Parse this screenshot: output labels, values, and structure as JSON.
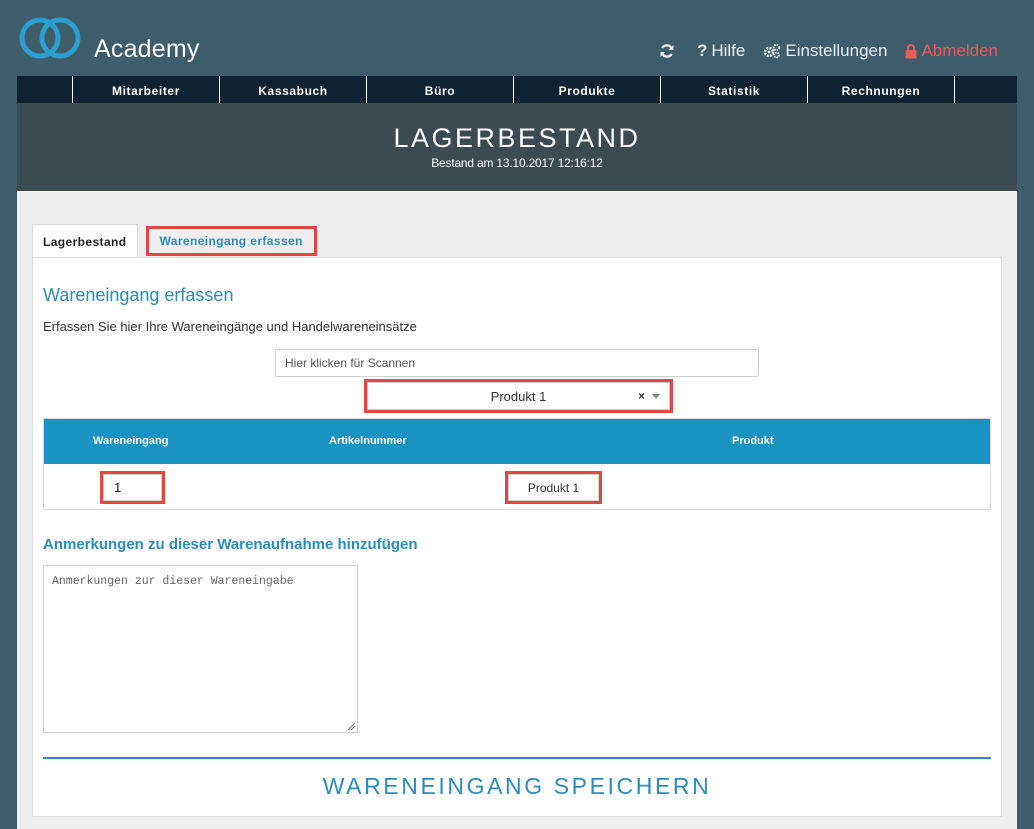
{
  "app": {
    "title": "Academy"
  },
  "top_actions": {
    "refresh_icon": "refresh-icon",
    "help": "Hilfe",
    "settings": "Einstellungen",
    "logout": "Abmelden"
  },
  "nav": {
    "items": [
      "Mitarbeiter",
      "Kassabuch",
      "Büro",
      "Produkte",
      "Statistik",
      "Rechnungen"
    ]
  },
  "banner": {
    "title": "LAGERBESTAND",
    "subtitle": "Bestand am 13.10.2017 12:16:12"
  },
  "tabs": [
    {
      "label": "Lagerbestand",
      "active": true
    },
    {
      "label": "Wareneingang erfassen",
      "active": false
    }
  ],
  "panel": {
    "heading": "Wareneingang erfassen",
    "description": "Erfassen Sie hier Ihre Wareneingänge und Handelwareneinsätze",
    "scan_placeholder": "Hier klicken für Scannen",
    "product_select": {
      "value": "Produkt 1",
      "clear": "×"
    }
  },
  "table": {
    "headers": [
      "Wareneingang",
      "Artikelnummer",
      "Produkt"
    ],
    "rows": [
      {
        "wareneingang": "1",
        "artikelnummer": "",
        "produkt": "Produkt 1"
      }
    ]
  },
  "notes": {
    "heading": "Anmerkungen zu dieser Warenaufnahme hinzufügen",
    "placeholder": "Anmerkungen zur dieser Wareneingabe"
  },
  "save_button": "WARENEINGANG SPEICHERN",
  "colors": {
    "background": "#3f5c6a",
    "navbar": "#0f2231",
    "banner": "#3c4b52",
    "accent": "#2a8dbf",
    "table_header": "#1b93c2",
    "highlight": "#e04848",
    "logout": "#ef5a5a"
  }
}
